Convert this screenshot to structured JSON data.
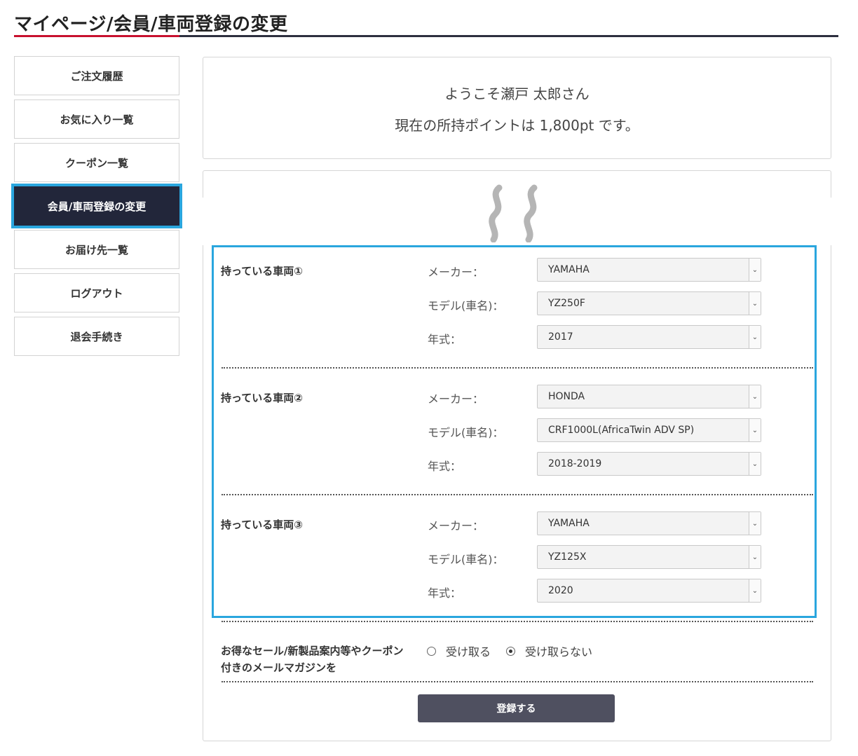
{
  "page": {
    "title": "マイページ/会員/車両登録の変更"
  },
  "sidebar": {
    "items": [
      {
        "label": "ご注文履歴",
        "active": false
      },
      {
        "label": "お気に入り一覧",
        "active": false
      },
      {
        "label": "クーポン一覧",
        "active": false
      },
      {
        "label": "会員/車両登録の変更",
        "active": true
      },
      {
        "label": "お届け先一覧",
        "active": false
      },
      {
        "label": "ログアウト",
        "active": false
      },
      {
        "label": "退会手続き",
        "active": false
      }
    ]
  },
  "welcome": {
    "line1": "ようこそ瀬戸 太郎さん",
    "line2": "現在の所持ポイントは 1,800pt です。"
  },
  "vehicles": [
    {
      "title": "持っている車両①",
      "maker_label": "メーカー：",
      "maker_value": "YAMAHA",
      "model_label": "モデル(車名)：",
      "model_value": "YZ250F",
      "year_label": "年式：",
      "year_value": "2017"
    },
    {
      "title": "持っている車両②",
      "maker_label": "メーカー：",
      "maker_value": "HONDA",
      "model_label": "モデル(車名)：",
      "model_value": "CRF1000L(AfricaTwin ADV SP)",
      "year_label": "年式：",
      "year_value": "2018-2019"
    },
    {
      "title": "持っている車両③",
      "maker_label": "メーカー：",
      "maker_value": "YAMAHA",
      "model_label": "モデル(車名)：",
      "model_value": "YZ125X",
      "year_label": "年式：",
      "year_value": "2020"
    }
  ],
  "newsletter": {
    "label": "お得なセール/新製品案内等やクーポン付きのメールマガジンを",
    "options": [
      {
        "label": "受け取る",
        "checked": false
      },
      {
        "label": "受け取らない",
        "checked": true
      }
    ]
  },
  "submit_label": "登録する",
  "colors": {
    "accent_red": "#c8102e",
    "nav_active_bg": "#22263a",
    "highlight_blue": "#2aa6de",
    "button_bg": "#4f5060"
  }
}
